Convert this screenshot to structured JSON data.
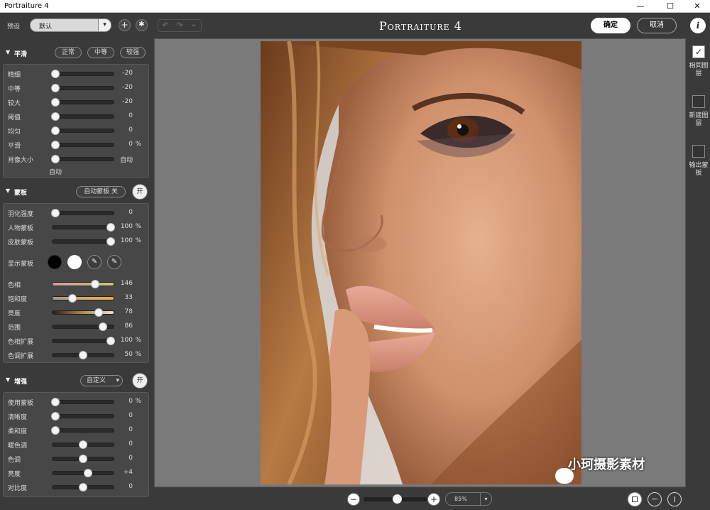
{
  "window": {
    "title": "Portraiture 4",
    "minimize": "—",
    "maximize": "☐",
    "close": "✕"
  },
  "toolbar": {
    "preset_label": "预设",
    "preset_value": "默认",
    "add": "+",
    "settings": "✱",
    "undo": "↶",
    "redo": "↷",
    "history": "⌄",
    "app_title": "Portraiture 4",
    "ok": "确定",
    "cancel": "取消",
    "info": "i"
  },
  "smoothing": {
    "title": "平滑",
    "modes": [
      "正常",
      "中等",
      "较强"
    ],
    "rows": [
      {
        "label": "精细",
        "value": "-20",
        "unit": "",
        "pos": 5
      },
      {
        "label": "中等",
        "value": "-20",
        "unit": "",
        "pos": 5
      },
      {
        "label": "较大",
        "value": "-20",
        "unit": "",
        "pos": 5
      },
      {
        "label": "阈值",
        "value": "0",
        "unit": "",
        "pos": 5
      },
      {
        "label": "均匀",
        "value": "0",
        "unit": "",
        "pos": 5
      },
      {
        "label": "平滑",
        "value": "0",
        "unit": "%",
        "pos": 5
      },
      {
        "label": "肖像大小",
        "value": "自动",
        "unit": "",
        "pos": 5
      }
    ],
    "size_sub": "自动"
  },
  "mask": {
    "title": "蒙板",
    "auto_mask": "自动蒙板 关",
    "toggle": "开",
    "rows": [
      {
        "label": "羽化强度",
        "value": "0",
        "unit": "",
        "pos": 5
      },
      {
        "label": "人物蒙板",
        "value": "100",
        "unit": "%",
        "pos": 95
      },
      {
        "label": "皮肤蒙板",
        "value": "100",
        "unit": "%",
        "pos": 95
      }
    ],
    "show_mask": "显示蒙板",
    "picker_add": "✎",
    "picker_sub": "✎",
    "color_rows": [
      {
        "label": "色相",
        "value": "146",
        "unit": "",
        "pos": 70
      },
      {
        "label": "饱和度",
        "value": "33",
        "unit": "",
        "pos": 33
      },
      {
        "label": "亮度",
        "value": "78",
        "unit": "",
        "pos": 75
      },
      {
        "label": "范围",
        "value": "86",
        "unit": "",
        "pos": 83
      },
      {
        "label": "色相扩展",
        "value": "100",
        "unit": "%",
        "pos": 95
      },
      {
        "label": "色调扩展",
        "value": "50",
        "unit": "%",
        "pos": 50
      }
    ]
  },
  "enhance": {
    "title": "增强",
    "preset": "自定义",
    "toggle": "开",
    "rows": [
      {
        "label": "使用蒙板",
        "value": "0",
        "unit": "%",
        "pos": 5
      },
      {
        "label": "清晰度",
        "value": "0",
        "unit": "",
        "pos": 5
      },
      {
        "label": "柔和度",
        "value": "0",
        "unit": "",
        "pos": 5
      },
      {
        "label": "暖色调",
        "value": "0",
        "unit": "",
        "pos": 50
      },
      {
        "label": "色调",
        "value": "0",
        "unit": "",
        "pos": 50
      },
      {
        "label": "亮度",
        "value": "+4",
        "unit": "",
        "pos": 58
      },
      {
        "label": "对比度",
        "value": "0",
        "unit": "",
        "pos": 50
      }
    ]
  },
  "output": [
    {
      "label": "相同图层",
      "checked": true
    },
    {
      "label": "新建图层",
      "checked": false
    },
    {
      "label": "输出蒙板",
      "checked": false
    }
  ],
  "zoom": {
    "minus": "−",
    "plus": "+",
    "value": "85%",
    "level": 45
  },
  "watermark": "小珂摄影素材",
  "colors": {
    "accent": "#ffffff",
    "panel": "#3a3a3a",
    "box": "#474747",
    "canvas": "#7a7a7a"
  }
}
